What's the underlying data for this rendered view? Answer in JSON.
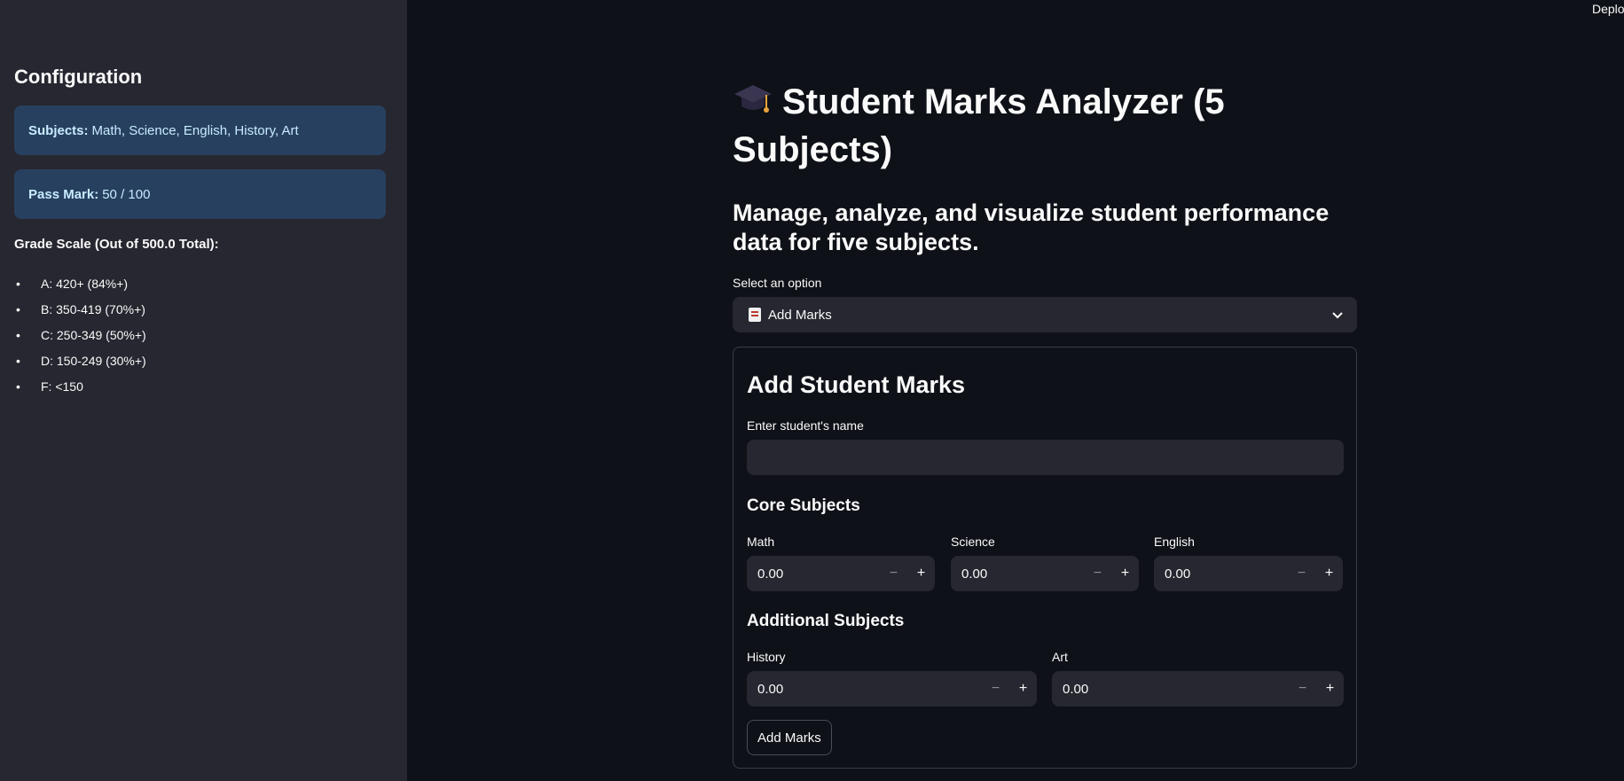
{
  "sidebar": {
    "heading": "Configuration",
    "subjects_label": "Subjects:",
    "subjects_value": "Math, Science, English, History, Art",
    "pass_label": "Pass Mark:",
    "pass_value": "50 / 100",
    "grade_heading": "Grade Scale (Out of 500.0 Total):",
    "grades": [
      "A: 420+ (84%+)",
      "B: 350-419 (70%+)",
      "C: 250-349 (50%+)",
      "D: 150-249 (30%+)",
      "F: <150"
    ]
  },
  "header": {
    "deploy": "Deploy"
  },
  "main": {
    "title": "Student Marks Analyzer (5 Subjects)",
    "subtitle": "Manage, analyze, and visualize student performance data for five subjects.",
    "select_label": "Select an option",
    "select_value": "Add Marks",
    "form": {
      "heading": "Add Student Marks",
      "name_label": "Enter student's name",
      "name_value": "",
      "core_heading": "Core Subjects",
      "additional_heading": "Additional Subjects",
      "subjects": [
        {
          "label": "Math",
          "value": "0.00"
        },
        {
          "label": "Science",
          "value": "0.00"
        },
        {
          "label": "English",
          "value": "0.00"
        },
        {
          "label": "History",
          "value": "0.00"
        },
        {
          "label": "Art",
          "value": "0.00"
        }
      ],
      "minus": "−",
      "plus": "+",
      "submit_label": "Add Marks"
    }
  },
  "colors": {
    "sidebar_bg": "#262730",
    "page_bg": "#0e1117",
    "info_bg": "#28405f",
    "info_text": "#c7ebff"
  }
}
